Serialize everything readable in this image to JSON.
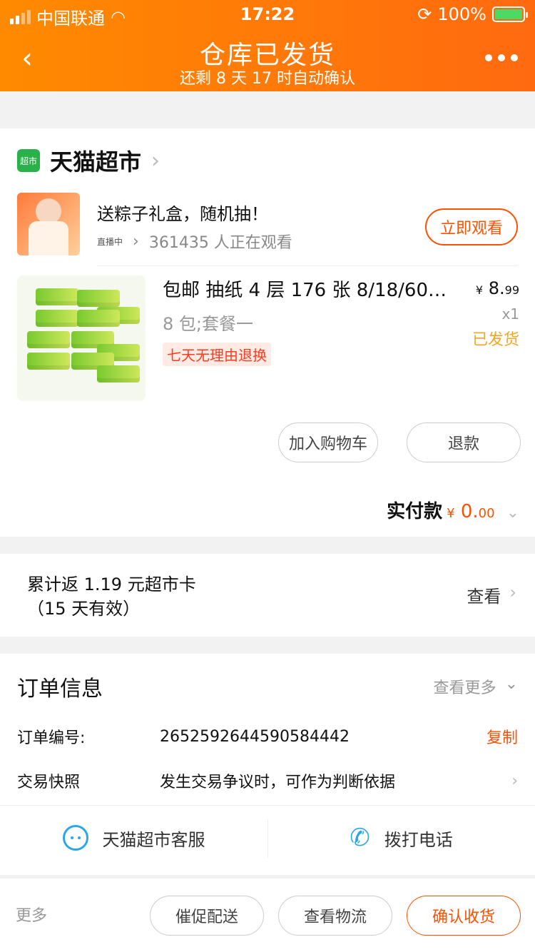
{
  "status_bar": {
    "carrier": "中国联通",
    "time": "17:22",
    "battery": "100%"
  },
  "header": {
    "title": "仓库已发货",
    "subtitle": "还剩 8 天 17 时自动确认"
  },
  "store": {
    "name": "天猫超市",
    "logo_text": "超市",
    "live": {
      "title": "送粽子礼盒，随机抽！",
      "tag": "直播中",
      "viewers": "361435 人正在观看",
      "watch_button": "立即观看"
    }
  },
  "product": {
    "title": "包邮 抽纸 4 层 176 张 8/18/60 …",
    "spec": "8 包;套餐一",
    "badge": "七天无理由退换",
    "price_yen": "¥",
    "price_int": "8.",
    "price_dec": "99",
    "qty": "x1",
    "ship_status": "已发货",
    "add_cart_label": "加入购物车",
    "refund_label": "退款"
  },
  "payment": {
    "label": "实付款",
    "yen": "¥",
    "int": "0.",
    "dec": "00"
  },
  "rebate": {
    "line1": "累计返 1.19 元超市卡",
    "line2": "（15 天有效）",
    "view_label": "查看"
  },
  "order": {
    "title": "订单信息",
    "more_label": "查看更多",
    "number_label": "订单编号:",
    "number_value": "2652592644590584442",
    "copy_label": "复制",
    "snapshot_label": "交易快照",
    "snapshot_value": "发生交易争议时，可作为判断依据",
    "service_label": "天猫超市客服",
    "call_label": "拨打电话"
  },
  "bottom": {
    "more": "更多",
    "urge": "催促配送",
    "track": "查看物流",
    "confirm": "确认收货"
  },
  "colors": {
    "accent": "#ff5000",
    "header_start": "#ff8a00",
    "header_end": "#ff6a10",
    "ship": "#f5a623",
    "service": "#2aa7e8"
  }
}
